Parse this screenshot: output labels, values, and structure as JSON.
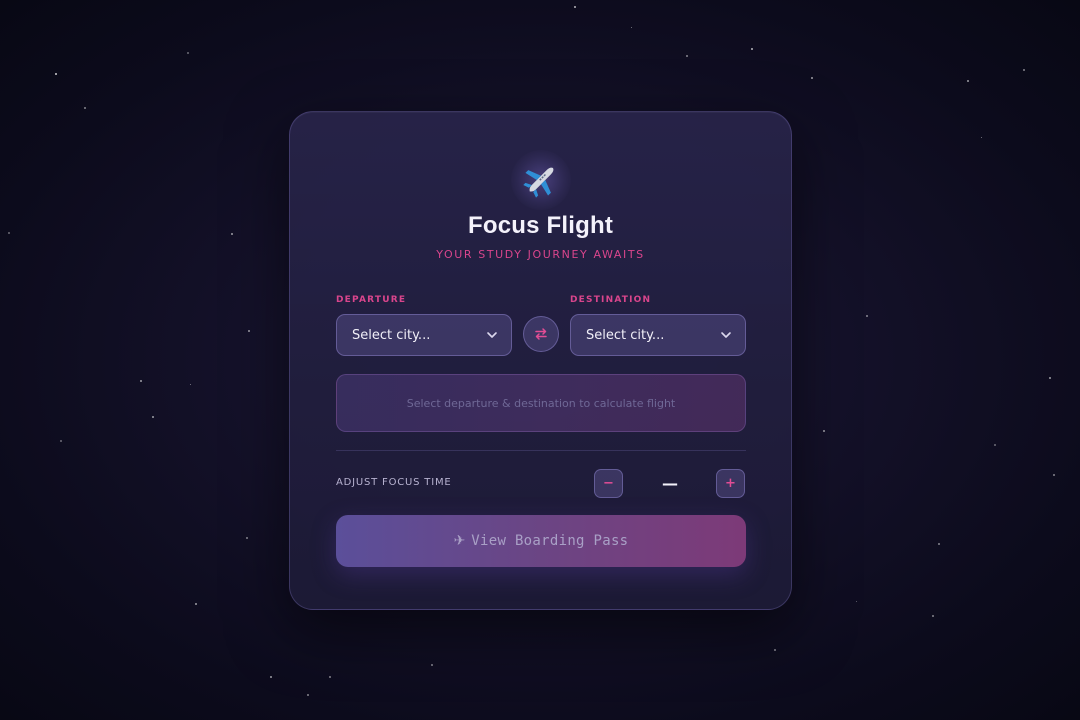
{
  "app": {
    "title": "Focus Flight",
    "subtitle": "YOUR STUDY JOURNEY AWAITS",
    "logo_icon": "airplane-icon"
  },
  "departure": {
    "label": "DEPARTURE",
    "value": "Select city...",
    "icon": "chevron-down-icon"
  },
  "destination": {
    "label": "DESTINATION",
    "value": "Select city...",
    "icon": "chevron-down-icon"
  },
  "swap": {
    "icon": "swap-arrows-icon"
  },
  "flight_info": {
    "message": "Select departure & destination to calculate flight"
  },
  "focus_time": {
    "label": "ADJUST FOCUS TIME",
    "value": "—",
    "decrement_label": "−",
    "increment_label": "+"
  },
  "cta": {
    "icon": "✈",
    "label": "View Boarding Pass"
  },
  "colors": {
    "accent": "#d9458c",
    "background": "#0c0b1c",
    "card": "#231f42"
  }
}
